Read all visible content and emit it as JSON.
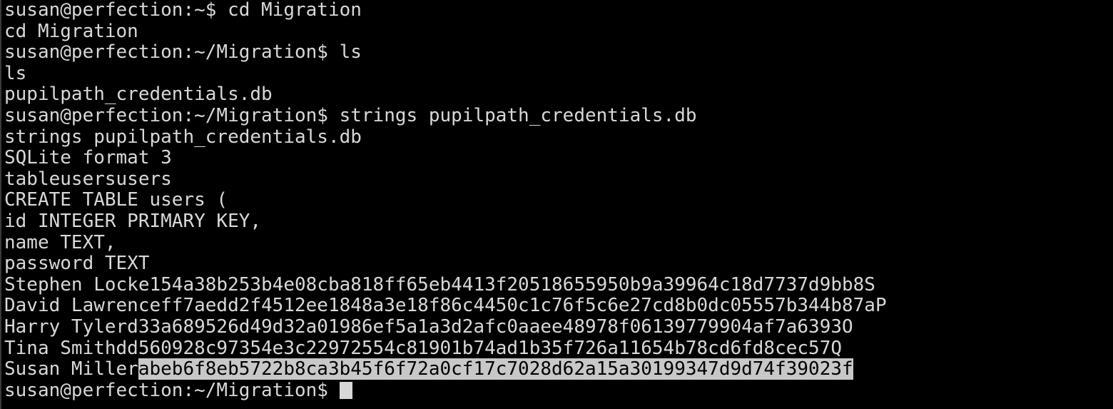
{
  "terminal": {
    "lines": [
      "susan@perfection:~$ cd Migration",
      "cd Migration",
      "susan@perfection:~/Migration$ ls",
      "ls",
      "pupilpath_credentials.db",
      "susan@perfection:~/Migration$ strings pupilpath_credentials.db",
      "strings pupilpath_credentials.db",
      "SQLite format 3",
      "tableusersusers",
      "CREATE TABLE users (",
      "id INTEGER PRIMARY KEY,",
      "name TEXT,",
      "password TEXT",
      "Stephen Locke154a38b253b4e08cba818ff65eb4413f20518655950b9a39964c18d7737d9bb8S",
      "David Lawrenceff7aedd2f4512ee1848a3e18f86c4450c1c76f5c6e27cd8b0dc05557b344b87aP",
      "Harry Tylerd33a689526d49d32a01986ef5a1a3d2afc0aaee48978f06139779904af7a6393O",
      "Tina Smithdd560928c97354e3c22972554c81901b74ad1b35f726a11654b78cd6fd8cec57Q"
    ],
    "selected_line": {
      "name": "Susan Miller",
      "hash": "abeb6f8eb5722b8ca3b45f6f72a0cf17c7028d62a15a30199347d9d74f39023f"
    },
    "prompt": "susan@perfection:~/Migration$ "
  }
}
